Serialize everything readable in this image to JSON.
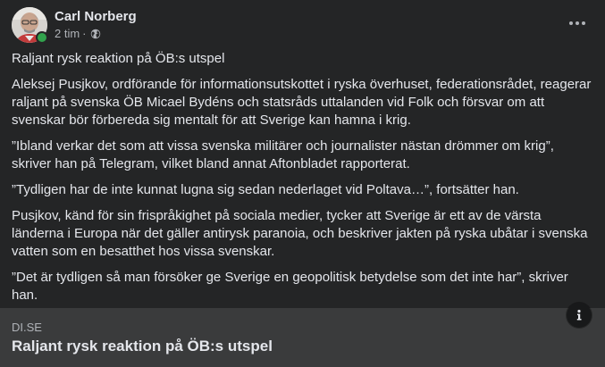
{
  "post": {
    "author": {
      "name": "Carl Norberg",
      "online": true
    },
    "timestamp": "2 tim",
    "separator": "·",
    "privacy_icon": "globe-icon",
    "more_icon": "more-options-icon",
    "paragraphs": [
      "Raljant rysk reaktion på ÖB:s utspel",
      "Aleksej Pusjkov, ordförande för informationsutskottet i ryska överhuset, federationsrådet, reagerar raljant på svenska ÖB Micael Bydéns och statsråds uttalanden vid Folk och försvar om att svenskar bör förbereda sig mentalt för att Sverige kan hamna i krig.",
      "”Ibland verkar det som att vissa svenska militärer och journalister nästan drömmer om krig”, skriver han på Telegram, vilket bland annat Aftonbladet rapporterat.",
      "”Tydligen har de inte kunnat lugna sig sedan nederlaget vid Poltava…”, fortsätter han.",
      "Pusjkov, känd för sin frispråkighet på sociala medier, tycker att Sverige är ett av de värsta länderna i Europa när det gäller antirysk paranoia, och beskriver jakten på ryska ubåtar i svenska vatten som en besatthet hos vissa svenskar.",
      "”Det är tydligen så man försöker ge Sverige en geopolitisk betydelse som det inte har”, skriver han."
    ]
  },
  "link_preview": {
    "domain": "DI.SE",
    "title": "Raljant rysk reaktion på ÖB:s utspel",
    "info_icon": "info-icon"
  },
  "colors": {
    "background": "#242526",
    "preview_background": "#3a3b3c",
    "primary_text": "#e4e6eb",
    "secondary_text": "#b0b3b8",
    "online_indicator": "#31a24c"
  }
}
